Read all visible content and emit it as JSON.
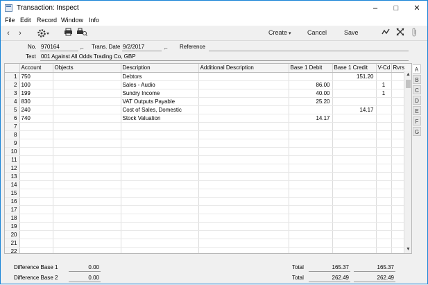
{
  "window": {
    "title": "Transaction: Inspect",
    "minimize": "–",
    "maximize": "□",
    "close": "✕"
  },
  "menu": [
    "File",
    "Edit",
    "Record",
    "Window",
    "Info"
  ],
  "toolbar": {
    "back": "‹",
    "forward": "›",
    "create_label": "Create",
    "cancel_label": "Cancel",
    "save_label": "Save"
  },
  "header": {
    "no_label": "No.",
    "no_value": "970164",
    "trans_date_label": "Trans. Date",
    "trans_date_value": "9/2/2017",
    "reference_label": "Reference",
    "reference_value": "",
    "text_label": "Text",
    "text_value": "001 Against All Odds Trading Co, GBP"
  },
  "grid": {
    "columns": [
      "",
      "Account",
      "Objects",
      "Description",
      "Additional Description",
      "Base 1 Debit",
      "Base 1 Credit",
      "V-Cd",
      "Rvrs"
    ],
    "rows": [
      {
        "n": "1",
        "account": "750",
        "objects": "",
        "description": "Debtors",
        "additional": "",
        "debit": "",
        "credit": "151.20",
        "vcd": "",
        "rvrs": ""
      },
      {
        "n": "2",
        "account": "100",
        "objects": "",
        "description": "Sales - Audio",
        "additional": "",
        "debit": "86.00",
        "credit": "",
        "vcd": "1",
        "rvrs": ""
      },
      {
        "n": "3",
        "account": "199",
        "objects": "",
        "description": "Sundry Income",
        "additional": "",
        "debit": "40.00",
        "credit": "",
        "vcd": "1",
        "rvrs": ""
      },
      {
        "n": "4",
        "account": "830",
        "objects": "",
        "description": "VAT Outputs Payable",
        "additional": "",
        "debit": "25.20",
        "credit": "",
        "vcd": "",
        "rvrs": ""
      },
      {
        "n": "5",
        "account": "240",
        "objects": "",
        "description": "Cost of Sales, Domestic",
        "additional": "",
        "debit": "",
        "credit": "14.17",
        "vcd": "",
        "rvrs": ""
      },
      {
        "n": "6",
        "account": "740",
        "objects": "",
        "description": "Stock Valuation",
        "additional": "",
        "debit": "14.17",
        "credit": "",
        "vcd": "",
        "rvrs": ""
      },
      {
        "n": "7",
        "account": "",
        "objects": "",
        "description": "",
        "additional": "",
        "debit": "",
        "credit": "",
        "vcd": "",
        "rvrs": ""
      },
      {
        "n": "8",
        "account": "",
        "objects": "",
        "description": "",
        "additional": "",
        "debit": "",
        "credit": "",
        "vcd": "",
        "rvrs": ""
      },
      {
        "n": "9",
        "account": "",
        "objects": "",
        "description": "",
        "additional": "",
        "debit": "",
        "credit": "",
        "vcd": "",
        "rvrs": ""
      },
      {
        "n": "10",
        "account": "",
        "objects": "",
        "description": "",
        "additional": "",
        "debit": "",
        "credit": "",
        "vcd": "",
        "rvrs": ""
      },
      {
        "n": "11",
        "account": "",
        "objects": "",
        "description": "",
        "additional": "",
        "debit": "",
        "credit": "",
        "vcd": "",
        "rvrs": ""
      },
      {
        "n": "12",
        "account": "",
        "objects": "",
        "description": "",
        "additional": "",
        "debit": "",
        "credit": "",
        "vcd": "",
        "rvrs": ""
      },
      {
        "n": "13",
        "account": "",
        "objects": "",
        "description": "",
        "additional": "",
        "debit": "",
        "credit": "",
        "vcd": "",
        "rvrs": ""
      },
      {
        "n": "14",
        "account": "",
        "objects": "",
        "description": "",
        "additional": "",
        "debit": "",
        "credit": "",
        "vcd": "",
        "rvrs": ""
      },
      {
        "n": "15",
        "account": "",
        "objects": "",
        "description": "",
        "additional": "",
        "debit": "",
        "credit": "",
        "vcd": "",
        "rvrs": ""
      },
      {
        "n": "16",
        "account": "",
        "objects": "",
        "description": "",
        "additional": "",
        "debit": "",
        "credit": "",
        "vcd": "",
        "rvrs": ""
      },
      {
        "n": "17",
        "account": "",
        "objects": "",
        "description": "",
        "additional": "",
        "debit": "",
        "credit": "",
        "vcd": "",
        "rvrs": ""
      },
      {
        "n": "18",
        "account": "",
        "objects": "",
        "description": "",
        "additional": "",
        "debit": "",
        "credit": "",
        "vcd": "",
        "rvrs": ""
      },
      {
        "n": "19",
        "account": "",
        "objects": "",
        "description": "",
        "additional": "",
        "debit": "",
        "credit": "",
        "vcd": "",
        "rvrs": ""
      },
      {
        "n": "20",
        "account": "",
        "objects": "",
        "description": "",
        "additional": "",
        "debit": "",
        "credit": "",
        "vcd": "",
        "rvrs": ""
      },
      {
        "n": "21",
        "account": "",
        "objects": "",
        "description": "",
        "additional": "",
        "debit": "",
        "credit": "",
        "vcd": "",
        "rvrs": ""
      },
      {
        "n": "22",
        "account": "",
        "objects": "",
        "description": "",
        "additional": "",
        "debit": "",
        "credit": "",
        "vcd": "",
        "rvrs": ""
      }
    ]
  },
  "tabs": [
    "A",
    "B",
    "C",
    "D",
    "E",
    "F",
    "G"
  ],
  "footer": {
    "diff1_label": "Difference Base 1",
    "diff1_value": "0.00",
    "diff2_label": "Difference Base 2",
    "diff2_value": "0.00",
    "total1_label": "Total",
    "total1_debit": "165.37",
    "total1_credit": "165.37",
    "total2_label": "Total",
    "total2_debit": "262.49",
    "total2_credit": "262.49"
  },
  "colors": {
    "window_border": "#1883d7",
    "grid_background": "#ffffff",
    "chrome_background": "#f0f0f0"
  },
  "icons": [
    "app-icon",
    "back-icon",
    "forward-icon",
    "gear-icon",
    "print-icon",
    "print-preview-icon",
    "create-dropdown-icon",
    "graph-icon",
    "expand-icon",
    "attachment-icon",
    "paste-icon",
    "scroll-up-icon",
    "scroll-down-icon"
  ]
}
